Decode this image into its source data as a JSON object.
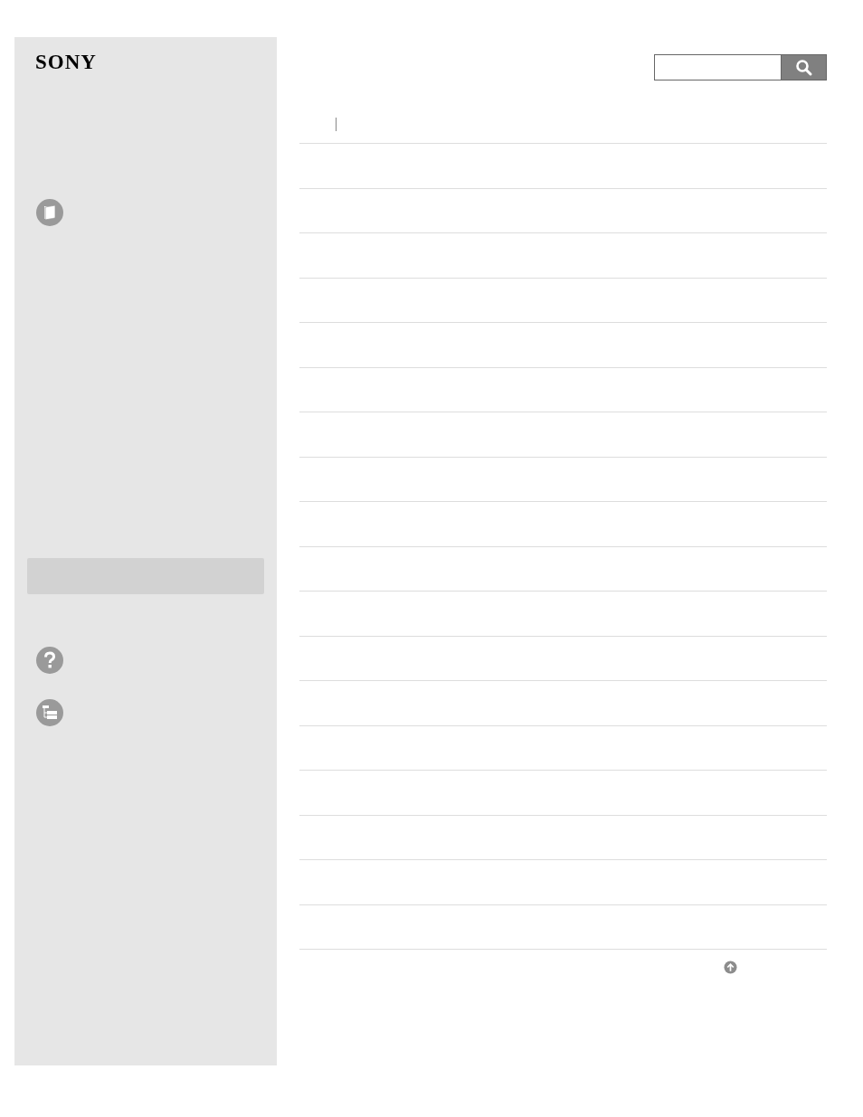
{
  "header": {
    "logo": "SONY"
  }
}
